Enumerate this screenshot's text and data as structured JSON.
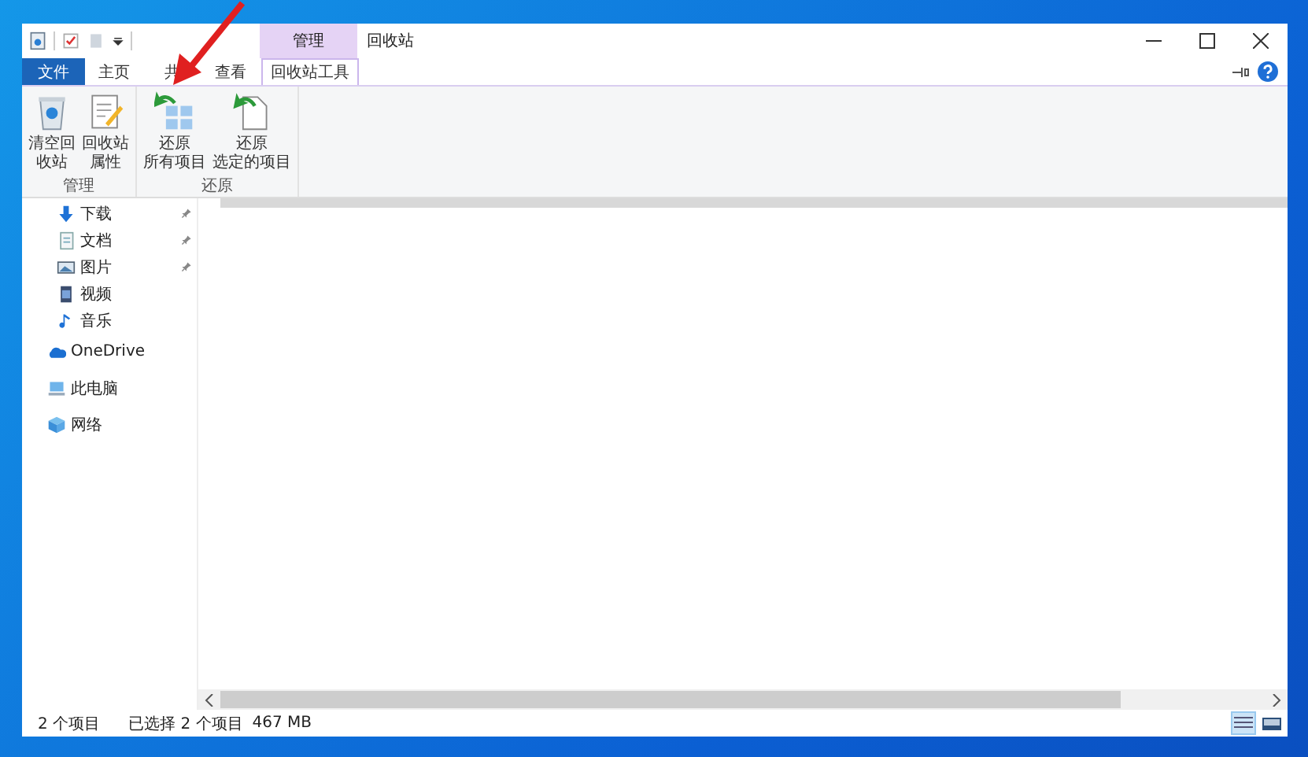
{
  "window": {
    "title": "回收站",
    "context_tab_header": "管理"
  },
  "tabs": [
    {
      "label": "文件",
      "kind": "file",
      "selected": false
    },
    {
      "label": "主页",
      "kind": "normal",
      "selected": false
    },
    {
      "label": "共",
      "kind": "normal",
      "selected": false
    },
    {
      "label": "查看",
      "kind": "normal",
      "selected": false
    },
    {
      "label": "回收站工具",
      "kind": "context",
      "selected": true
    }
  ],
  "ribbon": {
    "groups": [
      {
        "label": "管理",
        "buttons": [
          {
            "lines": [
              "清空回",
              "收站"
            ]
          },
          {
            "lines": [
              "回收站",
              "属性"
            ]
          }
        ]
      },
      {
        "label": "还原",
        "buttons": [
          {
            "lines": [
              "还原",
              "所有项目"
            ]
          },
          {
            "lines": [
              "还原",
              "选定的项目"
            ]
          }
        ]
      }
    ]
  },
  "sidebar": {
    "items": [
      {
        "label": "下载",
        "kind": "quick",
        "pinned": true
      },
      {
        "label": "文档",
        "kind": "quick",
        "pinned": true
      },
      {
        "label": "图片",
        "kind": "quick",
        "pinned": true
      },
      {
        "label": "视频",
        "kind": "quick",
        "pinned": false
      },
      {
        "label": "音乐",
        "kind": "quick",
        "pinned": false
      },
      {
        "label": "OneDrive",
        "kind": "root",
        "pinned": false
      },
      {
        "label": "此电脑",
        "kind": "root",
        "pinned": false
      },
      {
        "label": "网络",
        "kind": "root",
        "pinned": false
      }
    ]
  },
  "status_bar": {
    "count": "2 个项目",
    "selection": "已选择 2 个项目",
    "size": "467 MB",
    "views": [
      {
        "kind": "details",
        "selected": true
      },
      {
        "kind": "large",
        "selected": false
      }
    ]
  }
}
